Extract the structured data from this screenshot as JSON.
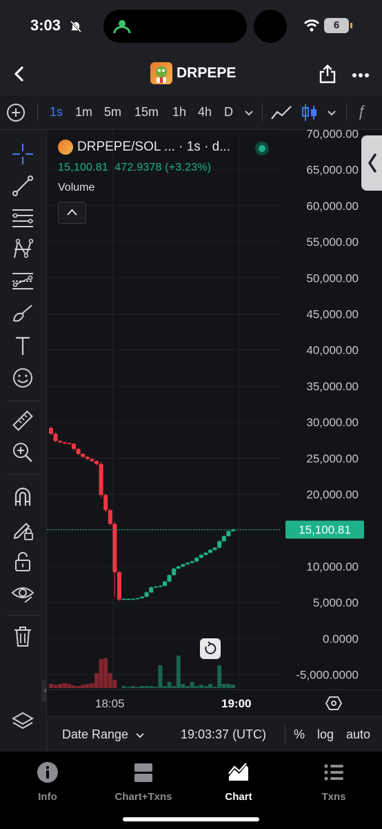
{
  "status_bar": {
    "time": "3:03",
    "battery": "6"
  },
  "header": {
    "token_name": "DRPEPE"
  },
  "timeframes": {
    "items": [
      "1s",
      "1m",
      "5m",
      "15m",
      "1h",
      "4h",
      "D"
    ],
    "active": "1s"
  },
  "legend": {
    "title": "DRPEPE/SOL ... · 1s · d...",
    "close": "15,100.81",
    "change": "472.9378 (+3.23%)",
    "volume_label": "Volume"
  },
  "price_axis": {
    "labels": [
      "70,000.00",
      "65,000.00",
      "60,000.00",
      "55,000.00",
      "50,000.00",
      "45,000.00",
      "40,000.00",
      "35,000.00",
      "30,000.00",
      "25,000.00",
      "20,000.00",
      "15,000.00",
      "10,000.00",
      "5,000.00",
      "0.0000",
      "-5,000.0000"
    ],
    "current_price_label": "15,100.81"
  },
  "time_axis": {
    "labels": [
      "18:05",
      "19:00"
    ]
  },
  "footer": {
    "date_range": "Date Range",
    "clock": "19:03:37 (UTC)",
    "percent": "%",
    "log": "log",
    "auto": "auto"
  },
  "tabs": [
    {
      "label": "Info"
    },
    {
      "label": "Chart+Txns"
    },
    {
      "label": "Chart"
    },
    {
      "label": "Txns"
    }
  ],
  "colors": {
    "up": "#1fb28a",
    "down": "#f23645",
    "accent": "#3d7df5"
  },
  "chart_data": {
    "type": "candlestick",
    "y_axis_range": [
      -5000,
      70000
    ],
    "current_price": 15100.81,
    "candles": [
      {
        "o": 29200,
        "c": 28400,
        "h": 29400,
        "l": 28200
      },
      {
        "o": 28400,
        "c": 27400,
        "h": 28600,
        "l": 27200
      },
      {
        "o": 27400,
        "c": 27200,
        "h": 27500,
        "l": 27000
      },
      {
        "o": 27200,
        "c": 27100,
        "h": 27300,
        "l": 26900
      },
      {
        "o": 27100,
        "c": 27000,
        "h": 27200,
        "l": 26900
      },
      {
        "o": 27000,
        "c": 26300,
        "h": 27100,
        "l": 26100
      },
      {
        "o": 26300,
        "c": 25600,
        "h": 26400,
        "l": 25400
      },
      {
        "o": 25600,
        "c": 25200,
        "h": 25700,
        "l": 25000
      },
      {
        "o": 25200,
        "c": 24900,
        "h": 25300,
        "l": 24700
      },
      {
        "o": 24900,
        "c": 24600,
        "h": 25000,
        "l": 24400
      },
      {
        "o": 24600,
        "c": 24200,
        "h": 24700,
        "l": 24000
      },
      {
        "o": 24200,
        "c": 19900,
        "h": 24500,
        "l": 19500
      },
      {
        "o": 19900,
        "c": 17800,
        "h": 20100,
        "l": 17500
      },
      {
        "o": 17800,
        "c": 15900,
        "h": 18000,
        "l": 15600
      },
      {
        "o": 15900,
        "c": 9200,
        "h": 16200,
        "l": 5800
      },
      {
        "o": 9200,
        "c": 5400,
        "h": 9400,
        "l": 5200
      },
      {
        "o": 5400,
        "c": 5500,
        "h": 5600,
        "l": 5300
      },
      {
        "o": 5500,
        "c": 5500,
        "h": 5600,
        "l": 5400
      },
      {
        "o": 5500,
        "c": 5500,
        "h": 5600,
        "l": 5400
      },
      {
        "o": 5500,
        "c": 5600,
        "h": 5700,
        "l": 5400
      },
      {
        "o": 5600,
        "c": 5800,
        "h": 5900,
        "l": 5500
      },
      {
        "o": 5800,
        "c": 6400,
        "h": 6500,
        "l": 5700
      },
      {
        "o": 6400,
        "c": 7100,
        "h": 7200,
        "l": 6300
      },
      {
        "o": 7100,
        "c": 7200,
        "h": 7300,
        "l": 7000
      },
      {
        "o": 7200,
        "c": 7300,
        "h": 7400,
        "l": 7100
      },
      {
        "o": 7300,
        "c": 7900,
        "h": 8000,
        "l": 7200
      },
      {
        "o": 7900,
        "c": 8800,
        "h": 8900,
        "l": 7800
      },
      {
        "o": 8800,
        "c": 9700,
        "h": 9800,
        "l": 8700
      },
      {
        "o": 9700,
        "c": 10000,
        "h": 10100,
        "l": 9600
      },
      {
        "o": 10000,
        "c": 10300,
        "h": 10400,
        "l": 9900
      },
      {
        "o": 10300,
        "c": 10500,
        "h": 10600,
        "l": 10200
      },
      {
        "o": 10500,
        "c": 10700,
        "h": 10800,
        "l": 10400
      },
      {
        "o": 10700,
        "c": 11200,
        "h": 11300,
        "l": 10600
      },
      {
        "o": 11200,
        "c": 11600,
        "h": 11700,
        "l": 11100
      },
      {
        "o": 11600,
        "c": 11900,
        "h": 12000,
        "l": 11500
      },
      {
        "o": 11900,
        "c": 12300,
        "h": 12400,
        "l": 11800
      },
      {
        "o": 12300,
        "c": 12600,
        "h": 12700,
        "l": 12200
      },
      {
        "o": 12600,
        "c": 13500,
        "h": 13600,
        "l": 12500
      },
      {
        "o": 13500,
        "c": 14200,
        "h": 14300,
        "l": 13400
      },
      {
        "o": 14200,
        "c": 14900,
        "h": 15000,
        "l": 14100
      },
      {
        "o": 14900,
        "c": 15100,
        "h": 15200,
        "l": 14800
      }
    ],
    "volume_relative": [
      0.1,
      0.08,
      0.1,
      0.12,
      0.1,
      0.06,
      0.05,
      0.08,
      0.1,
      0.12,
      0.36,
      0.7,
      0.72,
      0.36,
      0.2,
      0.0,
      0.05,
      0.03,
      0.05,
      0.03,
      0.05,
      0.05,
      0.05,
      0.03,
      0.55,
      0.05,
      0.15,
      0.05,
      0.78,
      0.1,
      0.05,
      0.15,
      0.05,
      0.08,
      0.05,
      0.1,
      0.03,
      0.55,
      0.1,
      0.1,
      0.08
    ]
  }
}
